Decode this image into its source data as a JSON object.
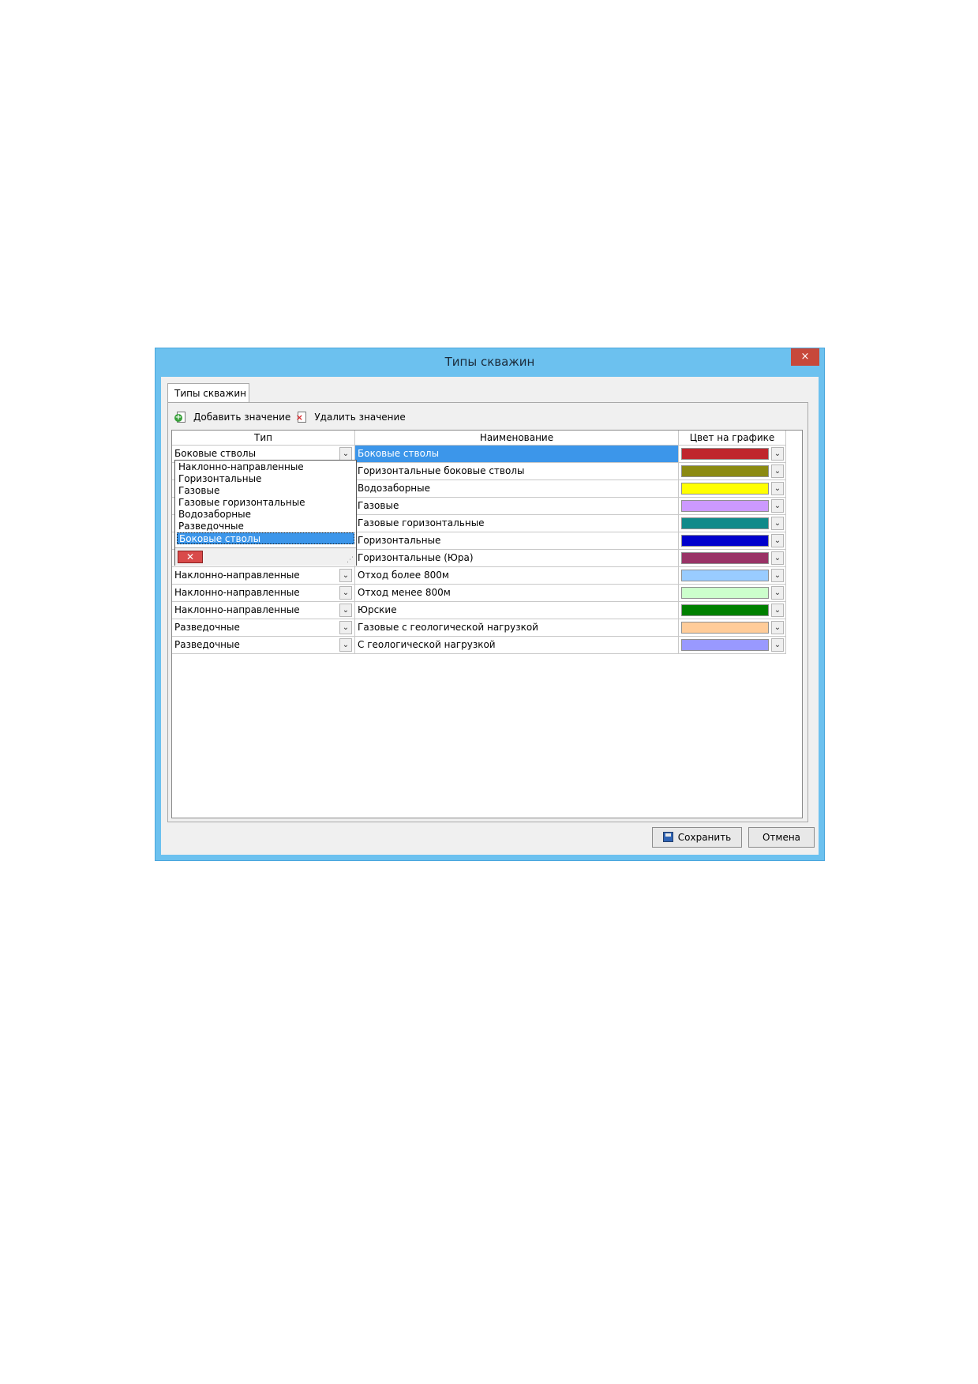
{
  "window": {
    "title": "Типы скважин",
    "close_label": "×"
  },
  "tab": {
    "label": "Типы скважин"
  },
  "toolbar": {
    "add_label": "Добавить значение",
    "delete_label": "Удалить значение"
  },
  "grid": {
    "columns": [
      "Тип",
      "Наименование",
      "Цвет на графике"
    ],
    "editing_type": "Боковые стволы",
    "rows": [
      {
        "type": "Боковые стволы",
        "name": "Боковые стволы",
        "color": "#c0262d"
      },
      {
        "type": "",
        "name": "Горизонтальные боковые стволы",
        "color": "#8b8a12"
      },
      {
        "type": "",
        "name": "Водозаборные",
        "color": "#ffff00"
      },
      {
        "type": "",
        "name": "Газовые",
        "color": "#cc99ff"
      },
      {
        "type": "",
        "name": "Газовые горизонтальные",
        "color": "#0f8a8a"
      },
      {
        "type": "",
        "name": "Горизонтальные",
        "color": "#0000cc"
      },
      {
        "type": "",
        "name": "Горизонтальные (Юра)",
        "color": "#993366"
      },
      {
        "type": "Наклонно-направленные",
        "name": "Отход более 800м",
        "color": "#99ccff"
      },
      {
        "type": "Наклонно-направленные",
        "name": "Отход менее 800м",
        "color": "#ccffcc"
      },
      {
        "type": "Наклонно-направленные",
        "name": "Юрские",
        "color": "#008000"
      },
      {
        "type": "Разведочные",
        "name": "Газовые с геологической нагрузкой",
        "color": "#ffcc99"
      },
      {
        "type": "Разведочные",
        "name": "С геологической нагрузкой",
        "color": "#9999ff"
      }
    ]
  },
  "dropdown": {
    "options": [
      "Наклонно-направленные",
      "Горизонтальные",
      "Газовые",
      "Газовые горизонтальные",
      "Водозаборные",
      "Разведочные",
      "Боковые стволы"
    ],
    "selected_index": 6,
    "clear_label": "✕"
  },
  "buttons": {
    "save_label": "Сохранить",
    "cancel_label": "Отмена"
  },
  "icons": {
    "add": "add-document-icon",
    "delete": "delete-document-icon",
    "save": "floppy-disk-icon",
    "dropdown": "chevron-down-icon",
    "close": "close-icon"
  }
}
